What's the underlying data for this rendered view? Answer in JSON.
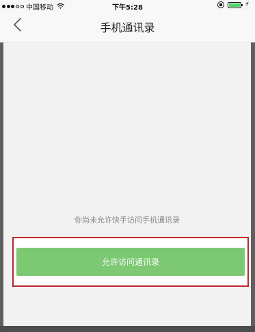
{
  "status_bar": {
    "carrier": "中国移动",
    "time": "下午5:28",
    "signal_bars": 3,
    "signal_total": 5,
    "battery_level": 1.0,
    "icons": [
      "signal-icon",
      "wifi-icon",
      "rotation-lock-icon",
      "battery-icon",
      "charging-icon"
    ]
  },
  "nav": {
    "title": "手机通讯录",
    "back_icon": "chevron-left-icon"
  },
  "main": {
    "hint": "你尚未允许快手访问手机通讯录",
    "allow_button_label": "允许访问通讯录"
  },
  "colors": {
    "accent_green": "#7dc873",
    "highlight_red": "#c0262c",
    "background": "#f2f2f2"
  }
}
